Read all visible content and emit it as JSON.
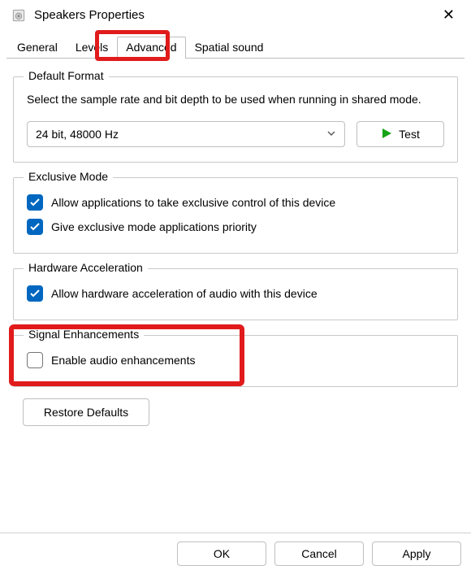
{
  "window": {
    "title": "Speakers Properties"
  },
  "tabs": {
    "general": "General",
    "levels": "Levels",
    "advanced": "Advanced",
    "spatial": "Spatial sound",
    "active": "advanced"
  },
  "defaultFormat": {
    "legend": "Default Format",
    "desc": "Select the sample rate and bit depth to be used when running in shared mode.",
    "selected": "24 bit, 48000 Hz",
    "test_label": "Test"
  },
  "exclusiveMode": {
    "legend": "Exclusive Mode",
    "allow_exclusive": {
      "label": "Allow applications to take exclusive control of this device",
      "checked": true
    },
    "priority": {
      "label": "Give exclusive mode applications priority",
      "checked": true
    }
  },
  "hardwareAccel": {
    "legend": "Hardware Acceleration",
    "allow": {
      "label": "Allow hardware acceleration of audio with this device",
      "checked": true
    }
  },
  "signalEnh": {
    "legend": "Signal Enhancements",
    "enable": {
      "label": "Enable audio enhancements",
      "checked": false
    }
  },
  "buttons": {
    "restore": "Restore Defaults",
    "ok": "OK",
    "cancel": "Cancel",
    "apply": "Apply"
  }
}
